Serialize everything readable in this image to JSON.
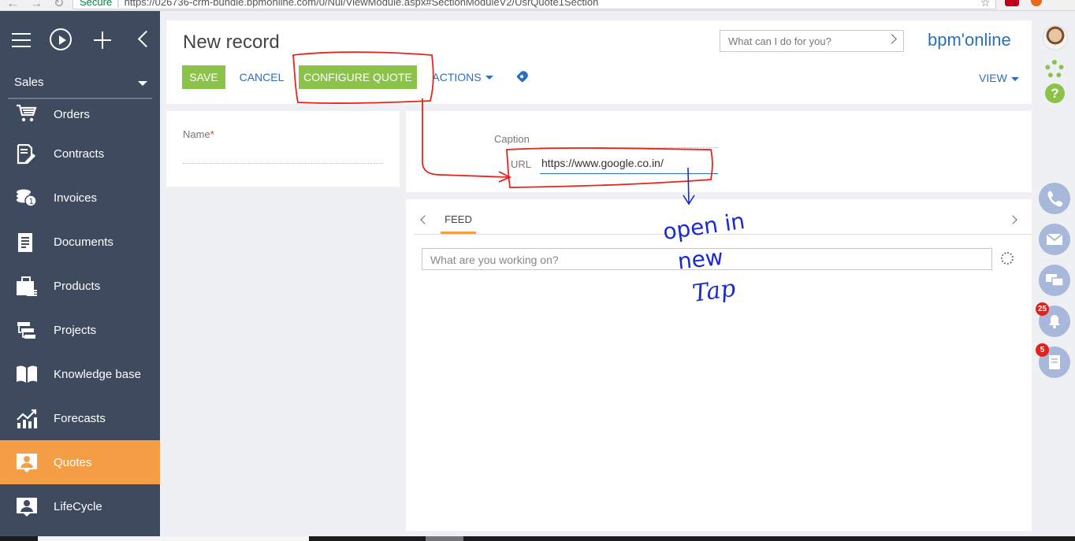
{
  "browser": {
    "secure_label": "Secure",
    "url": "https://026736-crm-bundle.bpmonline.com/0/Nui/ViewModule.aspx#SectionModuleV2/UsrQuote1Section"
  },
  "sidebar": {
    "section": "Sales",
    "items": [
      {
        "label": "Orders",
        "icon": "cart-icon"
      },
      {
        "label": "Contracts",
        "icon": "contract-icon"
      },
      {
        "label": "Invoices",
        "icon": "invoice-icon"
      },
      {
        "label": "Documents",
        "icon": "document-icon"
      },
      {
        "label": "Products",
        "icon": "products-icon"
      },
      {
        "label": "Projects",
        "icon": "projects-icon"
      },
      {
        "label": "Knowledge base",
        "icon": "book-icon"
      },
      {
        "label": "Forecasts",
        "icon": "chart-icon"
      },
      {
        "label": "Quotes",
        "icon": "quote-icon",
        "active": true
      },
      {
        "label": "LifeCycle",
        "icon": "lifecycle-icon"
      }
    ]
  },
  "header": {
    "title": "New record",
    "save": "SAVE",
    "cancel": "CANCEL",
    "configure": "CONFIGURE QUOTE",
    "actions": "ACTIONS",
    "search_placeholder": "What can I do for you?",
    "brand": "bpm'online",
    "view": "VIEW"
  },
  "form": {
    "name_label": "Name",
    "required_mark": "*",
    "caption_label": "Caption",
    "url_label": "URL",
    "url_value": "https://www.google.co.in/"
  },
  "feed": {
    "tab": "FEED",
    "placeholder": "What are you working on?"
  },
  "rail": {
    "notifications_count": "25",
    "tasks_count": "5"
  },
  "annotation": {
    "text_line1": "open in",
    "text_line2": "new",
    "text_line3": "Tap"
  },
  "colors": {
    "sidebar": "#3e4a5e",
    "active": "#f59e45",
    "accent": "#2d70b6",
    "green": "#8bc34a",
    "annotation_red": "#e8231b",
    "annotation_blue": "#1a2bd1"
  }
}
